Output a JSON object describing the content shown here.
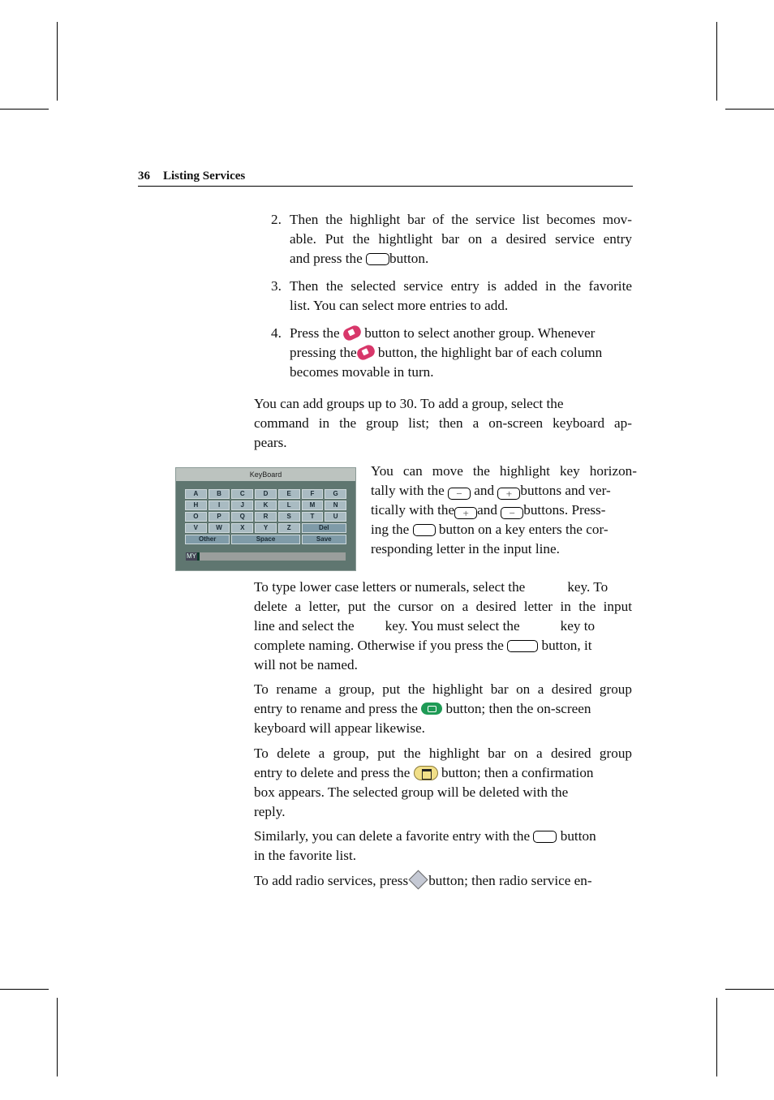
{
  "header": {
    "page_number": "36",
    "section_title": "Listing Services"
  },
  "steps": [
    {
      "number": "2.",
      "lines": [
        "Then the highlight bar of the service list becomes mov-",
        "able.  Put the hightlight bar on a desired service entry",
        [
          "and press the",
          "button."
        ]
      ]
    },
    {
      "number": "3.",
      "lines": [
        "Then the selected service entry is added in the favorite",
        "list. You can select more entries to add."
      ]
    },
    {
      "number": "4.",
      "lines": [
        [
          "Press the",
          "button to select another group.  Whenever"
        ],
        [
          "pressing the",
          "button, the highlight bar of each column"
        ],
        "becomes movable in turn."
      ]
    }
  ],
  "para_groups": [
    "You can add groups up to 30. To add a group, select the",
    "command in the group list; then a on-screen keyboard ap-",
    "pears."
  ],
  "para_move": {
    "l1": "You can move the highlight key horizon-",
    "l2a": "tally with the",
    "l2b": "and",
    "l2c": "buttons and ver-",
    "l3a": "tically with the",
    "l3b": "and",
    "l3c": "buttons. Press-",
    "l4a": "ing the",
    "l4b": "button on a key enters the cor-",
    "l5": "responding letter in the input line.",
    "minus": "−",
    "plus": "+"
  },
  "para_lower": {
    "l1a": "To type lower case letters or numerals, select the",
    "l1b": "key. To",
    "l2": "delete a letter, put the cursor on a desired letter in the input",
    "l3a": "line and select the",
    "l3b": "key.  You must select the",
    "l3c": "key to",
    "l4a": "complete naming.  Otherwise if you press the",
    "l4b": "button, it",
    "l5": "will not be named."
  },
  "para_rename": {
    "l1": "To rename a group, put the highlight bar on a desired group",
    "l2a": "entry to rename and press the",
    "l2b": "button; then the on-screen",
    "l3": "keyboard will appear likewise."
  },
  "para_delete": {
    "l1": "To delete a group, put the highlight bar on a desired group",
    "l2a": "entry to delete and press the",
    "l2b": "button; then a confirmation",
    "l3": "box appears.  The selected group will be deleted with the",
    "l4": "reply."
  },
  "para_favorite": {
    "l1a": "Similarly, you can delete a favorite entry with the",
    "l1b": "button",
    "l2": "in the favorite list."
  },
  "para_radio": {
    "l1a": "To add radio services, press",
    "l1b": "button; then radio service en-"
  },
  "keyboard": {
    "title": "KeyBoard",
    "rows": [
      [
        "A",
        "B",
        "C",
        "D",
        "E",
        "F",
        "G"
      ],
      [
        "H",
        "I",
        "J",
        "K",
        "L",
        "M",
        "N"
      ],
      [
        "O",
        "P",
        "Q",
        "R",
        "S",
        "T",
        "U"
      ],
      [
        "V",
        "W",
        "X",
        "Y",
        "Z"
      ]
    ],
    "del_label": "Del",
    "other_label": "Other",
    "space_label": "Space",
    "save_label": "Save",
    "input_value": "MY"
  },
  "icons": {
    "pink": "pink-group-button-icon",
    "green": "green-rename-button-icon",
    "yellow": "yellow-delete-button-icon",
    "radio": "radio-button-icon"
  }
}
